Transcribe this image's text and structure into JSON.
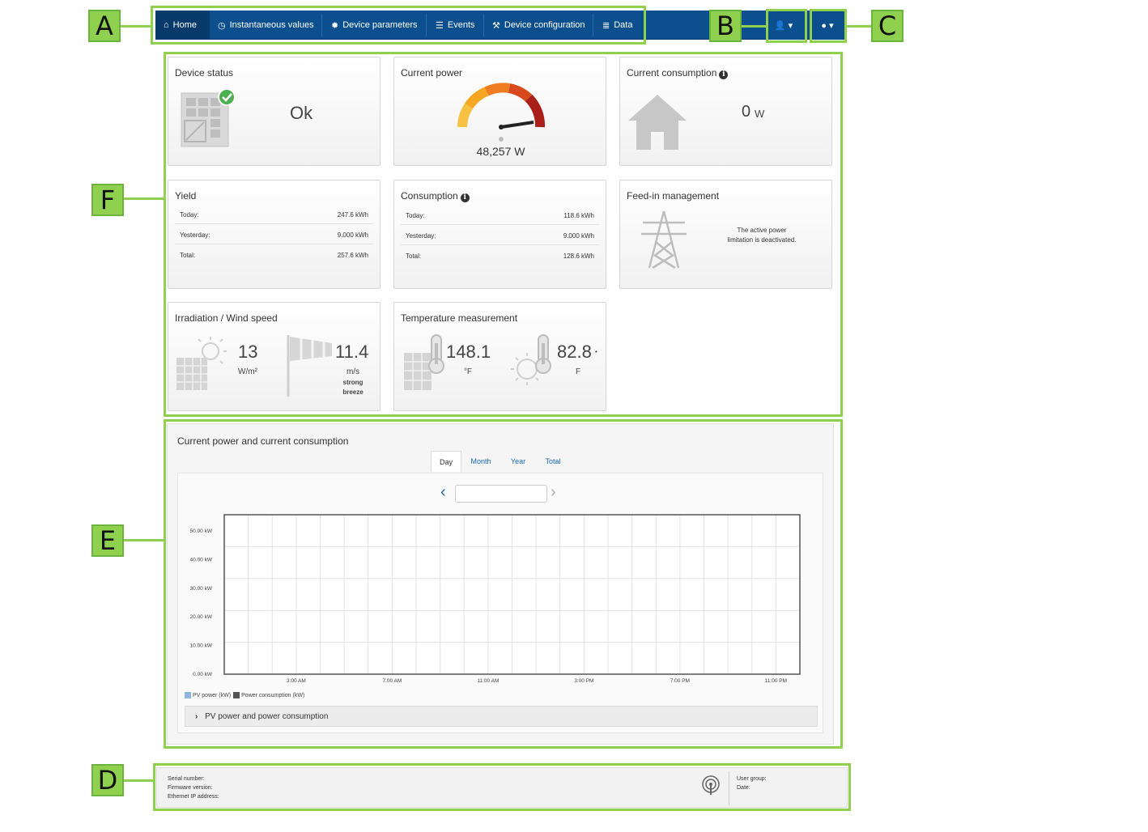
{
  "callouts": [
    "A",
    "B",
    "C",
    "D",
    "E",
    "F"
  ],
  "nav": {
    "items": [
      {
        "label": "Home",
        "icon": "home-icon",
        "glyph": "⌂"
      },
      {
        "label": "Instantaneous values",
        "icon": "gauge-icon",
        "glyph": "◷"
      },
      {
        "label": "Device parameters",
        "icon": "gear-icon",
        "glyph": "✹"
      },
      {
        "label": "Events",
        "icon": "list-icon",
        "glyph": "☰"
      },
      {
        "label": "Device configuration",
        "icon": "wrench-icon",
        "glyph": "⚒"
      },
      {
        "label": "Data",
        "icon": "database-icon",
        "glyph": "≣"
      }
    ],
    "user_glyph": "👤 ▾",
    "help_glyph": "● ▾"
  },
  "tiles": {
    "device_status": {
      "title": "Device status",
      "value": "Ok"
    },
    "current_power": {
      "title": "Current power",
      "value": "48,257 W"
    },
    "current_consumption": {
      "title": "Current consumption",
      "value": "0",
      "unit": "W"
    },
    "yield": {
      "title": "Yield",
      "rows": [
        {
          "label": "Today:",
          "value": "247.6 kWh"
        },
        {
          "label": "Yesterday:",
          "value": "9.000 kWh"
        },
        {
          "label": "Total:",
          "value": "257.6 kWh"
        }
      ]
    },
    "consumption": {
      "title": "Consumption",
      "rows": [
        {
          "label": "Today:",
          "value": "118.6 kWh"
        },
        {
          "label": "Yesterday:",
          "value": "9.000 kWh"
        },
        {
          "label": "Total:",
          "value": "128.6 kWh"
        }
      ]
    },
    "feed_in": {
      "title": "Feed-in management",
      "text_line1": "The active power",
      "text_line2": "limitation is deactivated."
    },
    "irradiation": {
      "title": "Irradiation / Wind speed",
      "irr_value": "13",
      "irr_unit": "W/m²",
      "wind_value": "11.4",
      "wind_unit": "m/s",
      "wind_desc1": "strong",
      "wind_desc2": "breeze"
    },
    "temperature": {
      "title": "Temperature measurement",
      "t1_value": "148.1",
      "t1_unit": "°F",
      "t2_value": "82.8",
      "t2_suffix": "•",
      "t2_unit": "F"
    }
  },
  "chart_panel": {
    "title": "Current power and current consumption",
    "tabs": [
      "Day",
      "Month",
      "Year",
      "Total"
    ],
    "active_tab": "Day",
    "date_value": "",
    "accordion_label": "PV power and power consumption"
  },
  "chart_data": {
    "type": "line",
    "x": [
      "3:00 AM",
      "7:00 AM",
      "11:00 AM",
      "3:00 PM",
      "7:00 PM",
      "11:00 PM"
    ],
    "y_ticks": [
      "50.00 kW",
      "40.00 kW",
      "30.00 kW",
      "20.00 kW",
      "10.00 kW",
      "0.00 kW"
    ],
    "ylim": [
      0,
      50
    ],
    "grid": true,
    "series": [
      {
        "name": "PV power (kW)",
        "values": [],
        "color": "#8fb7e0"
      },
      {
        "name": "Power consumption (kW)",
        "values": [],
        "color": "#555555"
      }
    ],
    "legend_position": "bottom-left"
  },
  "footer": {
    "serial_label": "Serial number:",
    "firmware_label": "Firmware version:",
    "ip_label": "Ethernet IP address:",
    "user_group_label": "User group:",
    "date_label": "Date:"
  },
  "colors": {
    "nav": "#0b4f8f",
    "annotation": "#8fd14f",
    "link": "#1a6bb4"
  }
}
